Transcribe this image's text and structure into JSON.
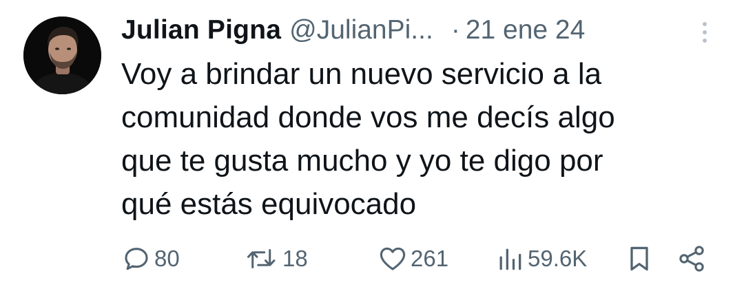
{
  "author": {
    "name": "Julian Pigna",
    "handle": "@JulianPi...",
    "avatar_icon": "profile-photo"
  },
  "meta": {
    "separator": "·",
    "date": "21 ene 24"
  },
  "tweet": {
    "lines": [
      "Voy a brindar un nuevo servicio a la",
      "comunidad donde vos me decís algo",
      "que te gusta mucho y yo te digo por",
      "qué estás equivocado"
    ]
  },
  "actions": {
    "replies": "80",
    "retweets": "18",
    "likes": "261",
    "views": "59.6K"
  },
  "icons": {
    "reply": "reply-icon",
    "retweet": "retweet-icon",
    "like": "heart-icon",
    "views": "views-icon",
    "bookmark": "bookmark-icon",
    "share": "share-icon",
    "more": "more-options-icon"
  },
  "colors": {
    "text": "#0f1419",
    "secondary": "#536471",
    "background": "#ffffff"
  }
}
